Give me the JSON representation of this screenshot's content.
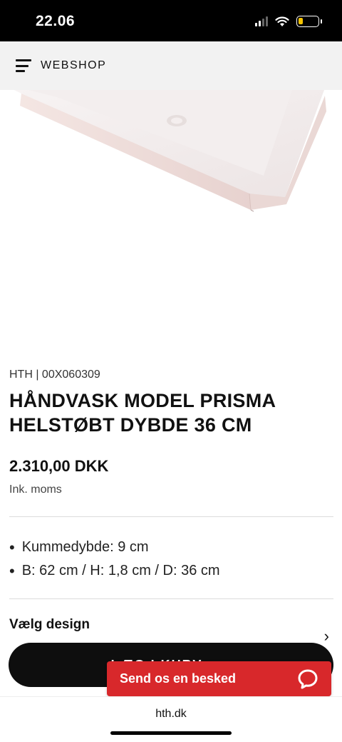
{
  "status_bar": {
    "time": "22.06",
    "icons": [
      "cellular-signal-icon",
      "wifi-icon",
      "battery-icon"
    ]
  },
  "nav": {
    "menu_icon": "hamburger-menu-icon",
    "title": "WEBSHOP"
  },
  "product": {
    "sku": "HTH | 00X060309",
    "title": "HÅNDVASK MODEL PRISMA HELSTØBT DYBDE 36 CM",
    "price": "2.310,00 DKK",
    "vat_note": "Ink. moms",
    "specs": [
      "Kummedybde: 9 cm",
      "B: 62 cm / H: 1,8 cm / D: 36 cm"
    ]
  },
  "design": {
    "label": "Vælg design",
    "chevron_icon": "chevron-right-icon"
  },
  "cart_button": {
    "label": "LÆG I KURV"
  },
  "chat": {
    "label": "Send os en besked",
    "icon": "chat-bubble-icon",
    "color": "#d8282b"
  },
  "browser": {
    "url": "hth.dk"
  }
}
